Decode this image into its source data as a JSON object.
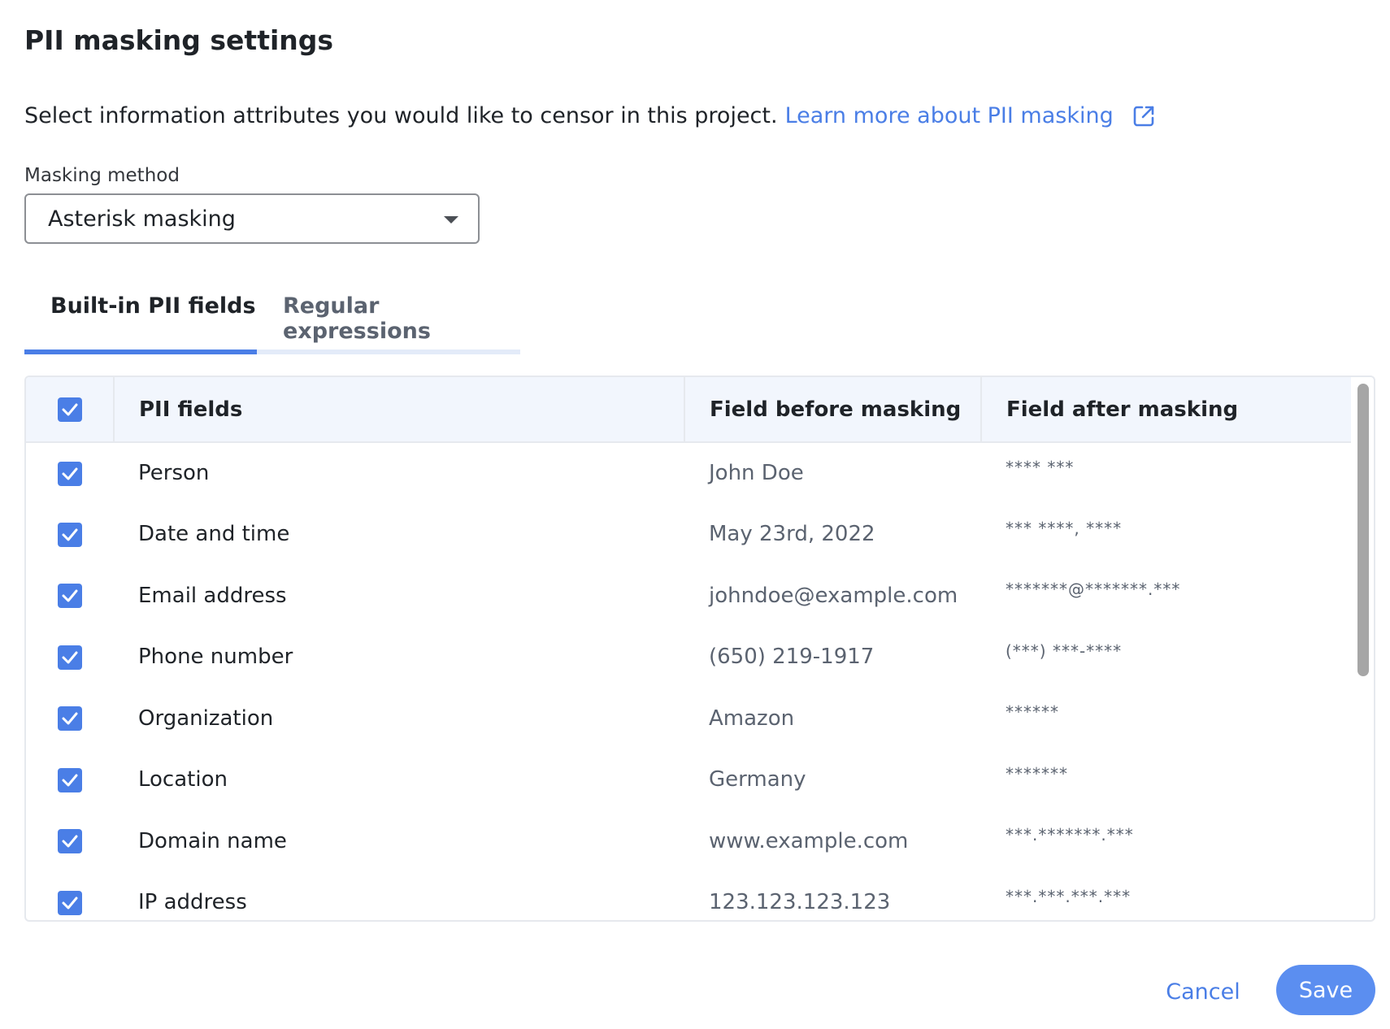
{
  "dialog": {
    "title": "PII masking settings",
    "description": "Select information attributes you would like to censor in this project.",
    "learn_more_link": "Learn more about PII masking",
    "learn_more_icon": "external-link-icon"
  },
  "masking_method": {
    "label": "Masking method",
    "selected": "Asterisk masking"
  },
  "tabs": [
    {
      "label": "Built-in PII fields",
      "active": true
    },
    {
      "label": "Regular expressions",
      "active": false
    }
  ],
  "table": {
    "headers": {
      "select_all_checked": true,
      "pii_fields": "PII fields",
      "before": "Field before masking",
      "after": "Field after masking"
    },
    "rows": [
      {
        "checked": true,
        "field": "Person",
        "before": "John Doe",
        "after": "**** ***"
      },
      {
        "checked": true,
        "field": "Date and time",
        "before": "May 23rd, 2022",
        "after": "*** ****, ****"
      },
      {
        "checked": true,
        "field": "Email address",
        "before": "johndoe@example.com",
        "after": "*******@*******.***"
      },
      {
        "checked": true,
        "field": "Phone number",
        "before": "(650) 219-1917",
        "after": "(***) ***-****"
      },
      {
        "checked": true,
        "field": "Organization",
        "before": "Amazon",
        "after": "******"
      },
      {
        "checked": true,
        "field": "Location",
        "before": "Germany",
        "after": "*******"
      },
      {
        "checked": true,
        "field": "Domain name",
        "before": "www.example.com",
        "after": "***.*******.***"
      },
      {
        "checked": true,
        "field": "IP address",
        "before": "123.123.123.123",
        "after": "***.***.***.***"
      }
    ]
  },
  "footer": {
    "cancel_label": "Cancel",
    "save_label": "Save"
  },
  "colors": {
    "accent": "#4a7ee6",
    "save_button": "#5b8ef0",
    "header_bg": "#f2f6fd"
  }
}
